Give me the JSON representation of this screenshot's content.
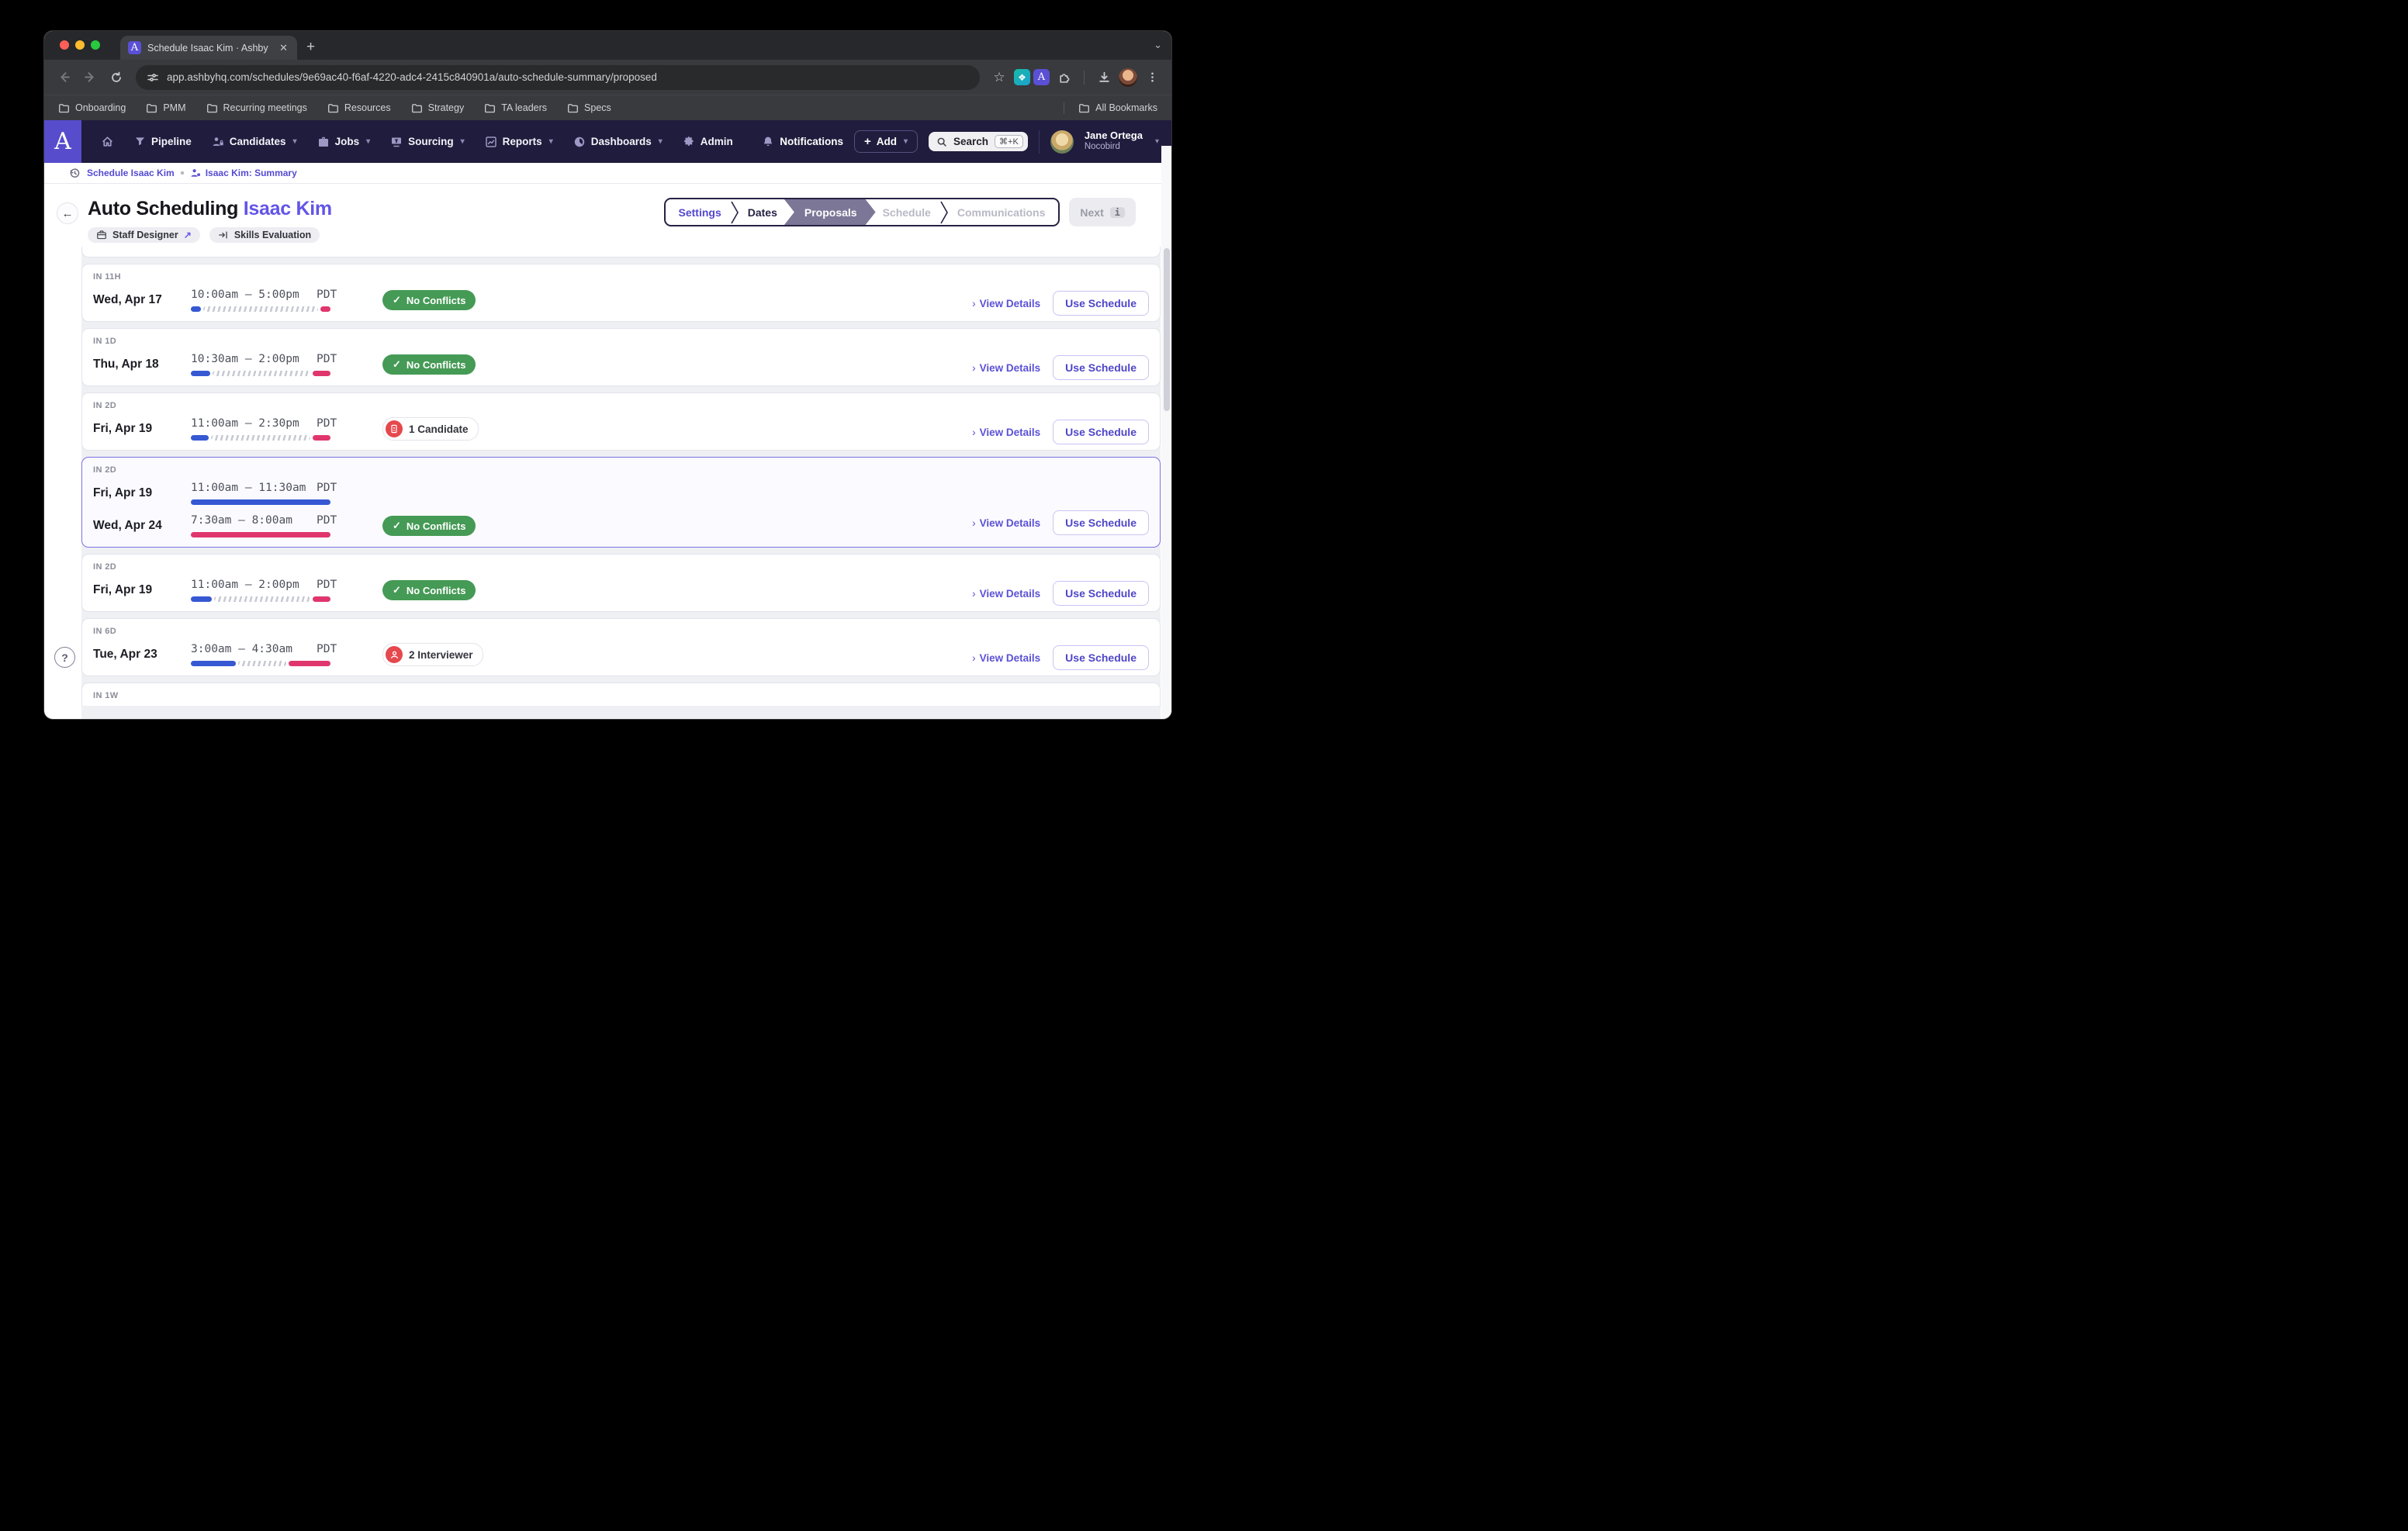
{
  "browser": {
    "tab_title": "Schedule Isaac Kim · Ashby",
    "favicon_letter": "A",
    "url": "app.ashbyhq.com/schedules/9e69ac40-f6af-4220-adc4-2415c840901a/auto-schedule-summary/proposed",
    "bookmarks": [
      "Onboarding",
      "PMM",
      "Recurring meetings",
      "Resources",
      "Strategy",
      "TA leaders",
      "Specs"
    ],
    "all_bookmarks_label": "All Bookmarks"
  },
  "nav": {
    "logo_letter": "A",
    "items": {
      "pipeline": "Pipeline",
      "candidates": "Candidates",
      "jobs": "Jobs",
      "sourcing": "Sourcing",
      "reports": "Reports",
      "dashboards": "Dashboards",
      "admin": "Admin"
    },
    "notifications_label": "Notifications",
    "add_label": "Add",
    "search_label": "Search",
    "search_shortcut": "⌘+K",
    "user_name": "Jane Ortega",
    "user_org": "Nocobird"
  },
  "breadcrumb": {
    "item1": "Schedule Isaac Kim",
    "item2": "Isaac Kim: Summary"
  },
  "header": {
    "title_prefix": "Auto Scheduling",
    "title_name": "Isaac Kim",
    "tag_job": "Staff Designer",
    "tag_job_link": "↗",
    "tag_stage": "Skills Evaluation",
    "steps": {
      "settings": "Settings",
      "dates": "Dates",
      "proposals": "Proposals",
      "schedule": "Schedule",
      "communications": "Communications"
    },
    "next_label": "Next",
    "next_key": "i"
  },
  "labels": {
    "view_details": "View Details",
    "use_schedule": "Use Schedule",
    "no_conflicts": "No Conflicts",
    "check": "✓",
    "help": "?"
  },
  "proposals": [
    {
      "eta": "IN 11H",
      "rows": [
        {
          "date": "Wed, Apr 17",
          "time": "10:00am — 5:00pm",
          "tz": "PDT",
          "blue_pct": 7,
          "pink_pct": 7
        }
      ],
      "badge": "No Conflicts"
    },
    {
      "eta": "IN 1D",
      "rows": [
        {
          "date": "Thu, Apr 18",
          "time": "10:30am — 2:00pm",
          "tz": "PDT",
          "blue_pct": 14,
          "pink_pct": 13
        }
      ],
      "badge": "No Conflicts"
    },
    {
      "eta": "IN 2D",
      "rows": [
        {
          "date": "Fri, Apr 19",
          "time": "11:00am — 2:30pm",
          "tz": "PDT",
          "blue_pct": 13,
          "pink_pct": 13
        }
      ],
      "badge": "1 Candidate"
    },
    {
      "eta": "IN 2D",
      "selected": true,
      "rows": [
        {
          "date": "Fri, Apr 19",
          "time": "11:00am — 11:30am",
          "tz": "PDT",
          "blue_pct": 100,
          "pink_pct": 0
        },
        {
          "date": "Wed, Apr 24",
          "time": "7:30am — 8:00am",
          "tz": "PDT",
          "blue_pct": 0,
          "pink_pct": 100
        }
      ],
      "badge": "No Conflicts"
    },
    {
      "eta": "IN 2D",
      "rows": [
        {
          "date": "Fri, Apr 19",
          "time": "11:00am — 2:00pm",
          "tz": "PDT",
          "blue_pct": 15,
          "pink_pct": 13
        }
      ],
      "badge": "No Conflicts"
    },
    {
      "eta": "IN 6D",
      "rows": [
        {
          "date": "Tue, Apr 23",
          "time": "3:00am — 4:30am",
          "tz": "PDT",
          "blue_pct": 32,
          "pink_pct": 30
        }
      ],
      "badge": "2 Interviewer"
    },
    {
      "eta": "IN 1W"
    }
  ],
  "colors": {
    "accent_purple": "#5b51d6",
    "nav_background": "#201c3d",
    "logo_purple": "#564ccc",
    "slot_blue": "#3658d3",
    "slot_pink": "#e0366e",
    "success_green": "#459a55",
    "alert_red": "#e5484d",
    "active_step": "#7c7697"
  }
}
